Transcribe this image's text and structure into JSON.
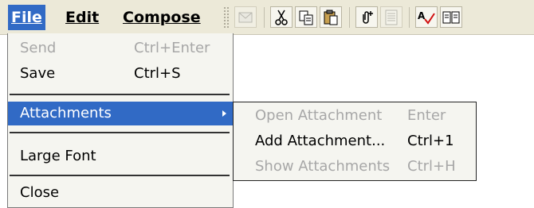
{
  "menubar": {
    "items": [
      {
        "label": "File",
        "active": true
      },
      {
        "label": "Edit",
        "active": false
      },
      {
        "label": "Compose",
        "active": false
      }
    ]
  },
  "toolbar": {
    "buttons": [
      {
        "icon": "envelope-icon",
        "glyph": "✉",
        "enabled": false
      },
      {
        "icon": "cut-icon",
        "glyph": "✂",
        "enabled": true
      },
      {
        "icon": "copy-icon",
        "glyph": "⎘",
        "enabled": true
      },
      {
        "icon": "paste-icon",
        "glyph": "📋",
        "enabled": true
      },
      {
        "icon": "attach-icon",
        "glyph": "⁺",
        "enabled": true
      },
      {
        "icon": "document-icon",
        "glyph": "☰",
        "enabled": false
      },
      {
        "icon": "spellcheck-icon",
        "glyph": "✓",
        "enabled": true
      },
      {
        "icon": "address-book-icon",
        "glyph": "📖",
        "enabled": true
      }
    ]
  },
  "file_menu": {
    "items": [
      {
        "label": "Send",
        "shortcut": "Ctrl+Enter",
        "disabled": true
      },
      {
        "label": "Save",
        "shortcut": "Ctrl+S",
        "disabled": false
      },
      {
        "label": "Attachments",
        "shortcut": "",
        "disabled": false,
        "highlighted": true,
        "has_submenu": true
      },
      {
        "label": "Large Font",
        "shortcut": "",
        "disabled": false
      },
      {
        "label": "Close",
        "shortcut": "",
        "disabled": false
      }
    ]
  },
  "attachments_submenu": {
    "items": [
      {
        "label": "Open Attachment",
        "shortcut": "Enter",
        "disabled": true
      },
      {
        "label": "Add Attachment...",
        "shortcut": "Ctrl+1",
        "disabled": false
      },
      {
        "label": "Show Attachments",
        "shortcut": "Ctrl+H",
        "disabled": true
      }
    ]
  },
  "colors": {
    "highlight": "#316ac5",
    "chrome": "#ece9d8",
    "menu_bg": "#f5f5f0",
    "disabled_text": "#a7a7a7"
  }
}
